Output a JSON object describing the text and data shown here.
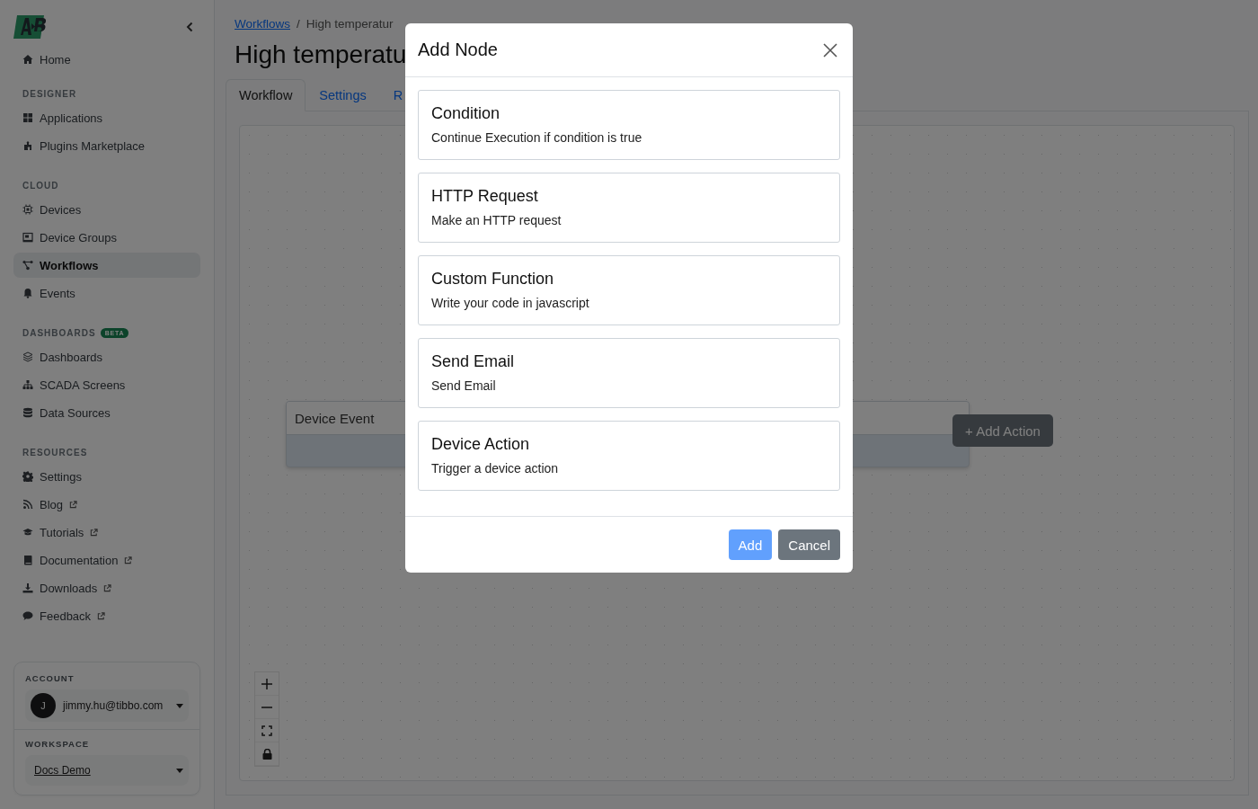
{
  "sidebar": {
    "sections": [
      {
        "items": [
          {
            "label": "Home",
            "selected": false,
            "external": false
          }
        ]
      },
      {
        "heading": "DESIGNER",
        "items": [
          {
            "label": "Applications",
            "selected": false,
            "external": false
          },
          {
            "label": "Plugins Marketplace",
            "selected": false,
            "external": false
          }
        ]
      },
      {
        "heading": "CLOUD",
        "items": [
          {
            "label": "Devices",
            "selected": false,
            "external": false
          },
          {
            "label": "Device Groups",
            "selected": false,
            "external": false
          },
          {
            "label": "Workflows",
            "selected": true,
            "external": false
          },
          {
            "label": "Events",
            "selected": false,
            "external": false
          }
        ]
      },
      {
        "heading": "DASHBOARDS",
        "badge": "BETA",
        "items": [
          {
            "label": "Dashboards",
            "selected": false,
            "external": false
          },
          {
            "label": "SCADA Screens",
            "selected": false,
            "external": false
          },
          {
            "label": "Data Sources",
            "selected": false,
            "external": false
          }
        ]
      },
      {
        "heading": "RESOURCES",
        "items": [
          {
            "label": "Settings",
            "selected": false,
            "external": false
          },
          {
            "label": "Blog",
            "selected": false,
            "external": true
          },
          {
            "label": "Tutorials",
            "selected": false,
            "external": true
          },
          {
            "label": "Documentation",
            "selected": false,
            "external": true
          },
          {
            "label": "Downloads",
            "selected": false,
            "external": true
          },
          {
            "label": "Feedback",
            "selected": false,
            "external": true
          }
        ]
      }
    ],
    "account": {
      "heading": "ACCOUNT",
      "avatar": "J",
      "email": "jimmy.hu@tibbo.com"
    },
    "workspace": {
      "heading": "WORKSPACE",
      "name": "Docs Demo"
    }
  },
  "breadcrumb": {
    "link": "Workflows",
    "separator": "/",
    "current": "High temperatur"
  },
  "title": "High temperatu",
  "tabs": [
    {
      "label": "Workflow",
      "selected": true
    },
    {
      "label": "Settings",
      "selected": false
    },
    {
      "label": "R",
      "selected": false
    }
  ],
  "canvas": {
    "node": {
      "title": "Device Event"
    },
    "add_action": "+ Add Action"
  },
  "modal": {
    "title": "Add Node",
    "options": [
      {
        "title": "Condition",
        "description": "Continue Execution if condition is true"
      },
      {
        "title": "HTTP Request",
        "description": "Make an HTTP request"
      },
      {
        "title": "Custom Function",
        "description": "Write your code in javascript"
      },
      {
        "title": "Send Email",
        "description": "Send Email"
      },
      {
        "title": "Device Action",
        "description": "Trigger a device action"
      }
    ],
    "buttons": [
      {
        "label": "Add",
        "kind": "primary",
        "disabled": true
      },
      {
        "label": "Cancel",
        "kind": "secondary",
        "disabled": false
      }
    ]
  }
}
